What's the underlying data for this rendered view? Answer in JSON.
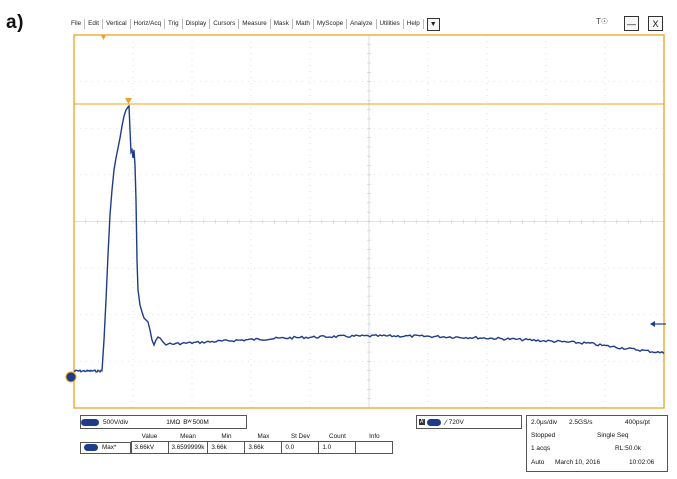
{
  "panel_label": "a)",
  "menu": [
    "File",
    "Edit",
    "Vertical",
    "Horiz/Acq",
    "Trig",
    "Display",
    "Cursors",
    "Measure",
    "Mask",
    "Math",
    "MyScope",
    "Analyze",
    "Utilities",
    "Help"
  ],
  "menu_dropdown_icon": "▼",
  "window": {
    "touch_off_label": "T☉",
    "minimize_icon": "—",
    "close_icon": "X"
  },
  "colors": {
    "trace": "#1e3c8a",
    "cursor": "#f0a020",
    "grid": "#c8c8c8"
  },
  "channel": {
    "scale": "500V/div",
    "coupling": "1MΩ",
    "bandwidth": "500M",
    "bw_symbol": "Bᵂ"
  },
  "trigger": {
    "source_marker": "A'",
    "slope_icon": "∕",
    "level": "720V"
  },
  "measure": {
    "headers": [
      "Value",
      "Mean",
      "Min",
      "Max",
      "St Dev",
      "Count",
      "Info"
    ],
    "row": {
      "name": "Max*",
      "value": "3.66kV",
      "mean": "3.6599999k",
      "min": "3.66k",
      "max": "3.66k",
      "stdev": "0.0",
      "count": "1.0",
      "info": ""
    }
  },
  "acquisition": {
    "timebase": "2.0µs/div",
    "sample_rate": "2.5GS/s",
    "resolution": "400ps/pt",
    "state": "Stopped",
    "mode": "Single Seq",
    "acqs": "1 acqs",
    "record_length": "RL:50.0k",
    "trigger_mode": "Auto",
    "date": "March 10, 2016",
    "time": "10:02:06"
  }
}
